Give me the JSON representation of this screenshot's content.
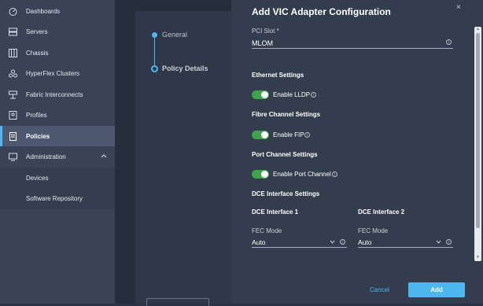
{
  "sidebar": {
    "items": [
      {
        "label": "Dashboards",
        "icon": "dashboard-icon"
      },
      {
        "label": "Servers",
        "icon": "server-icon"
      },
      {
        "label": "Chassis",
        "icon": "chassis-icon"
      },
      {
        "label": "HyperFlex Clusters",
        "icon": "cluster-icon"
      },
      {
        "label": "Fabric Interconnects",
        "icon": "fabric-icon"
      },
      {
        "label": "Profiles",
        "icon": "profile-icon"
      },
      {
        "label": "Policies",
        "icon": "policy-icon"
      },
      {
        "label": "Administration",
        "icon": "admin-icon"
      }
    ],
    "sub_items": [
      {
        "label": "Devices"
      },
      {
        "label": "Software Repository"
      }
    ]
  },
  "wizard": {
    "steps": [
      {
        "label": "General"
      },
      {
        "label": "Policy Details"
      }
    ]
  },
  "modal": {
    "title": "Add VIC Adapter Configuration",
    "close": "×",
    "pci_slot": {
      "label": "PCI Slot *",
      "value": "MLOM"
    },
    "ethernet": {
      "section": "Ethernet Settings",
      "toggle_label": "Enable LLDP"
    },
    "fibre": {
      "section": "Fibre Channel Settings",
      "toggle_label": "Enable FIP"
    },
    "port_channel": {
      "section": "Port Channel Settings",
      "toggle_label": "Enable Port Channel"
    },
    "dce": {
      "section": "DCE Interface Settings",
      "interfaces": [
        {
          "title": "DCE Interface 1",
          "fec_label": "FEC Mode",
          "fec_value": "Auto"
        },
        {
          "title": "DCE Interface 2",
          "fec_label": "FEC Mode",
          "fec_value": "Auto"
        }
      ]
    },
    "cancel_label": "Cancel",
    "add_label": "Add"
  },
  "colors": {
    "accent": "#4db7f0",
    "toggle_on": "#3ea34c"
  }
}
